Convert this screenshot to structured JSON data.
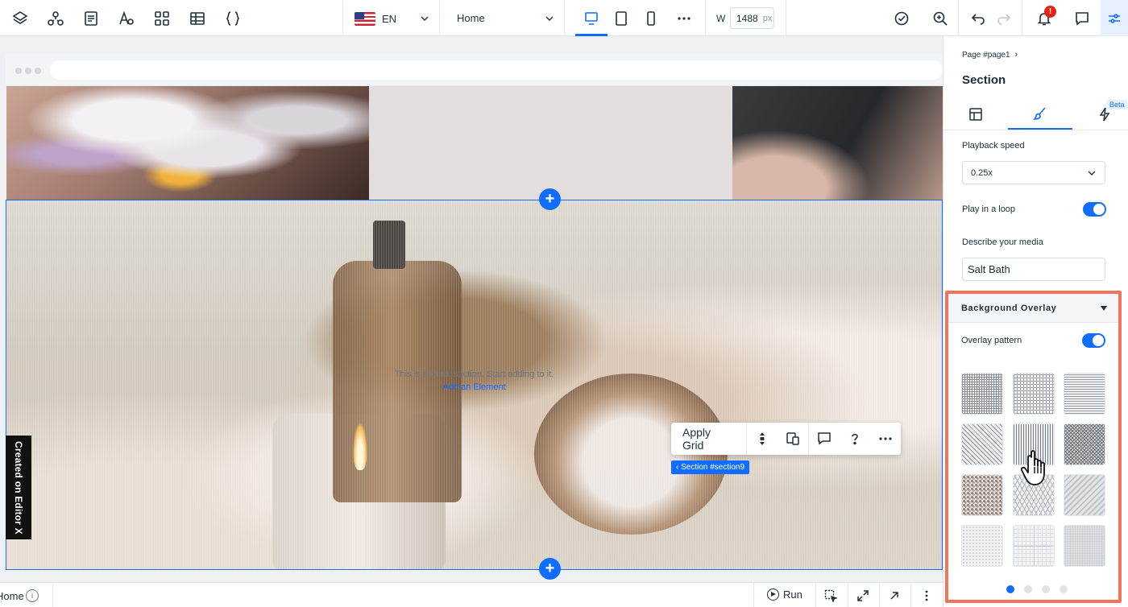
{
  "topbar": {
    "language": "EN",
    "page": "Home",
    "width_label": "W",
    "width_value": "1488",
    "width_unit": "px",
    "notification_count": "!",
    "icons": [
      "layers-icon",
      "components-icon",
      "pages-icon",
      "typography-icon",
      "apps-icon",
      "table-icon",
      "code-icon",
      "desktop-icon",
      "tablet-icon",
      "mobile-icon",
      "more-icon",
      "check-icon",
      "zoom-icon",
      "undo-icon",
      "redo-icon",
      "bell-icon",
      "comment-icon",
      "panel-toggle-icon"
    ]
  },
  "canvas": {
    "blank_message": "This is a blank section. Start adding to it.",
    "add_element": "Add an Element",
    "toolbar": {
      "apply_grid": "Apply Grid"
    },
    "section_tag": "‹ Section #section9",
    "created_badge": "Created on Editor X"
  },
  "bottombar": {
    "home": "Home",
    "info": "i",
    "run": "Run"
  },
  "panel": {
    "breadcrumb": "Page #page1",
    "title": "Section",
    "beta": "Beta",
    "playback_label": "Playback speed",
    "playback_value": "0.25x",
    "loop_label": "Play in a loop",
    "loop_on": true,
    "describe_label": "Describe your media",
    "describe_value": "Salt Bath",
    "overlay_title": "Background Overlay",
    "overlay_pattern_label": "Overlay pattern",
    "overlay_on": true,
    "pagination_active": 1,
    "pagination_count": 4
  },
  "colors": {
    "accent": "#116dff",
    "highlight": "#f4745a",
    "notification": "#e62214"
  }
}
